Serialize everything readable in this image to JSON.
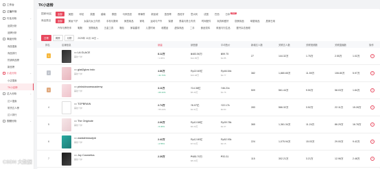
{
  "sidebar": {
    "items": [
      {
        "label": "工作台",
        "type": "item"
      },
      {
        "label": "达播市场",
        "type": "item"
      },
      {
        "label": "行业分析",
        "type": "item",
        "arrow": "⌄"
      },
      {
        "label": "商品分析",
        "type": "item",
        "arrow": "⌄"
      },
      {
        "label": "小店分析",
        "type": "item",
        "arrow": "⌄"
      },
      {
        "label": "达人分析",
        "type": "item",
        "arrow": "⌄"
      },
      {
        "label": "视频分析",
        "type": "item",
        "arrow": "⌄"
      }
    ],
    "subs": [
      "品类分析",
      "品牌分析",
      "商品搜索",
      "商品排行",
      "热销商品榜",
      "新品榜",
      "小店搜索",
      "TK小店榜",
      "达人搜索",
      "带货达人榜",
      "达人排行"
    ]
  },
  "page": {
    "title": "TK小店榜"
  },
  "filters": {
    "country_label": "国家/地区",
    "countries": [
      "全部",
      "美国",
      "印尼",
      "英国",
      "越南",
      "泰国",
      "马来西亚",
      "菲律宾",
      "新加坡",
      "墨西哥",
      "西班牙",
      "意大利",
      "法国",
      "巴西",
      "日本"
    ],
    "new_badge": "NEW",
    "category_label": "商品类目",
    "categories_row1": [
      "全部",
      "美妆个护",
      "女装与女士内衣",
      "手机与数码",
      "家居用品",
      "家电",
      "运动与户外",
      "保健",
      "男装与男士内衣",
      "时尚配件",
      "玩具和爱好",
      "厨房用品",
      "母婴用品",
      "居家日用"
    ],
    "categories_row2": [
      "汽车与摩托车",
      "鞋靴",
      "宠物用品",
      "五金工具",
      "箱包",
      "家装建材",
      "儿童时尚",
      "收藏品",
      "虚拟商品",
      "二手",
      "食品饮料",
      "珠宝与衍生品",
      "图书杂志音频"
    ]
  },
  "tabs": {
    "items": [
      "日榜",
      "周榜",
      "月榜"
    ],
    "date": "2025年 11月 16日 ⌄"
  },
  "table": {
    "headers": [
      "排名",
      "店铺信息",
      "销量",
      "销售额",
      "平均售价",
      "新增达人数",
      "关联达人数",
      "关联视频数",
      "关联直播数",
      "操作"
    ],
    "rows": [
      {
        "rank": "1",
        "badge": "gold",
        "name": "LA GLACE",
        "tag": "美妆个护",
        "sales": "8.12万",
        "sales_sub": "↑1.96%",
        "revenue": "฿483.56万",
        "revenue_sub": "$14.95万",
        "price": "฿59.75",
        "price_sub": "$1.85",
        "new_creators": "27",
        "creators": "144.32万",
        "videos": "1.75万",
        "lives": "2.55万",
        "extra": "1.02万"
      },
      {
        "rank": "2",
        "badge": "silver",
        "name": "glad2glow indo",
        "tag": "美妆个护",
        "sales": "4.86万",
        "sales_sub": "↓11.71%",
        "revenue": "Rp22.60亿",
        "revenue_sub": "$13.48万",
        "price": "Rp46.54k",
        "price_sub": "$2.77",
        "new_creators": "382",
        "creators": "1,880.65万",
        "videos": "11.59万",
        "lives": "106.80万",
        "extra": "5.97万"
      },
      {
        "rank": "3",
        "badge": "bronze",
        "name": "pinkskincareacademy",
        "tag": "美妆个护",
        "sales": "3.11万",
        "sales_sub": "↓60.11%",
        "revenue": "₫14.38亿",
        "revenue_sub": "$5.46万",
        "price": "₫46.21k",
        "price_sub": "$1.76",
        "new_creators": "509",
        "creators": "561.44万",
        "videos": "9.50万",
        "lives": "58.03万",
        "extra": "1.84万"
      },
      {
        "rank": "4",
        "badge": "plain",
        "name": "TOPBRAIN",
        "tag": "美妆个护",
        "sales": "2.74万",
        "sales_sub": "↑55.42%",
        "revenue": "₫6.07亿",
        "revenue_sub": "$2.31万",
        "price": "₫22.17k",
        "price_sub": "$0.84",
        "new_creators": "283",
        "creators": "566.32万",
        "videos": "3.52万",
        "lives": "22.11万",
        "extra": "15.28万"
      },
      {
        "rank": "5",
        "badge": "plain",
        "name": "The Originote",
        "tag": "美妆个护",
        "sales": "2.66万",
        "sales_sub": "↓5.30%",
        "revenue": "Rp10.58亿",
        "revenue_sub": "$6.30万",
        "price": "Rp39.78k",
        "price_sub": "$2.37",
        "new_creators": "365",
        "creators": "1,361.34万",
        "videos": "11.24万",
        "lives": "86.29万",
        "extra": "16.78万"
      },
      {
        "rank": "6",
        "badge": "plain",
        "name": "wardahbeautyid",
        "tag": "美妆个护",
        "sales": "2.42万",
        "sales_sub": "↓2.55%",
        "revenue": "Rp12.80亿",
        "revenue_sub": "$7.62万",
        "price": "Rp52.93k",
        "price_sub": "$3.15",
        "new_creators": "224",
        "creators": "1,075.94万",
        "videos": "15.03万",
        "lives": "29.00万",
        "extra": "9.42万"
      },
      {
        "rank": "7",
        "badge": "plain",
        "name": "Joy Cosmetics",
        "tag": "美妆个护",
        "sales": "2.39万",
        "sales_sub": "",
        "revenue": "₱485.79万",
        "revenue_sub": "$8.30万",
        "price": "₱20.31",
        "price_sub": "",
        "new_creators": "115",
        "creators": "302.21万",
        "videos": "3.21万",
        "lives": "12.96万",
        "extra": "2.48万"
      }
    ]
  },
  "colors": {
    "accent": "#e8495e"
  },
  "watermark": "CSDN 大数据"
}
